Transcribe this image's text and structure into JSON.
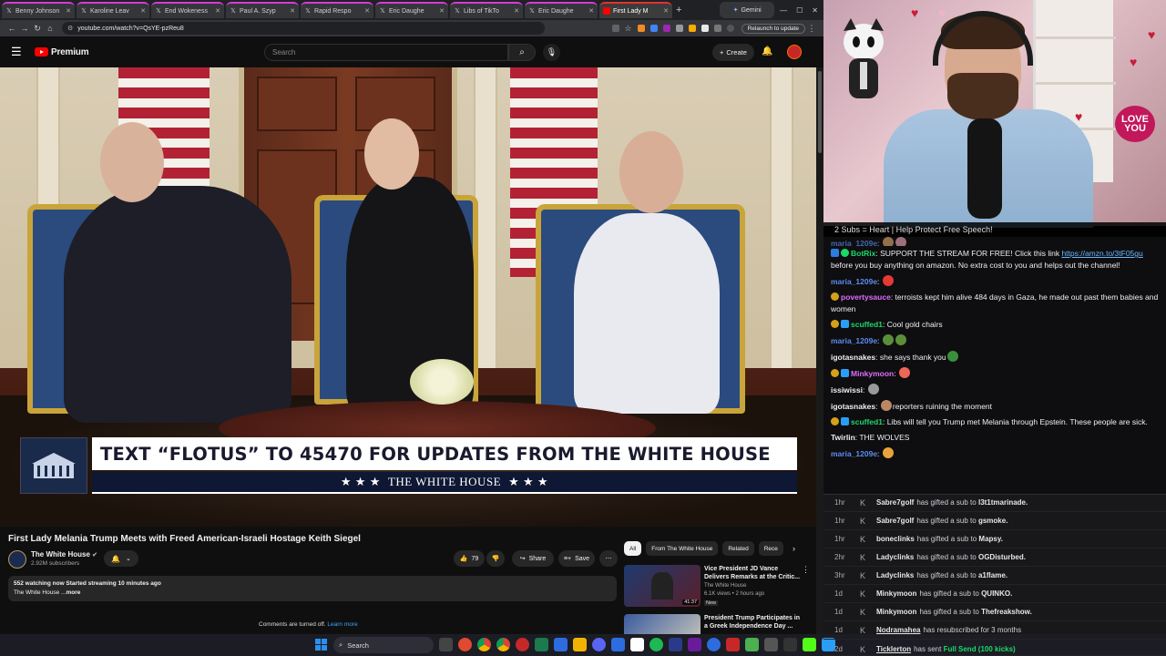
{
  "browser": {
    "tabs": [
      {
        "label": "Benny Johnson",
        "icon": "x-icon",
        "active": false
      },
      {
        "label": "Karoline Leav",
        "icon": "x-icon",
        "active": false
      },
      {
        "label": "End Wokeness",
        "icon": "x-icon",
        "active": false
      },
      {
        "label": "Paul A. Szyp",
        "icon": "x-icon",
        "active": false
      },
      {
        "label": "Rapid Respo",
        "icon": "x-icon",
        "active": false
      },
      {
        "label": "Eric Daughe",
        "icon": "x-icon",
        "active": false
      },
      {
        "label": "Libs of TikTo",
        "icon": "x-icon",
        "active": false
      },
      {
        "label": "Eric Daughe",
        "icon": "x-icon",
        "active": false
      },
      {
        "label": "First Lady M",
        "icon": "youtube-icon",
        "active": true
      }
    ],
    "gemini_tab": "Gemini",
    "url": "youtube.com/watch?v=QsYE-pzReu8",
    "relaunch": "Relaunch to update"
  },
  "youtube": {
    "logo_text": "Premium",
    "search_placeholder": "Search",
    "create_label": "Create",
    "video": {
      "lower_third_main": "TEXT “FLOTUS” TO 45470 FOR UPDATES FROM THE WHITE HOUSE",
      "lower_third_sub": "THE WHITE HOUSE",
      "stars": "★ ★ ★"
    },
    "title": "First Lady Melania Trump Meets with Freed American-Israeli Hostage Keith Siegel",
    "channel": {
      "name": "The White House",
      "subs": "2.92M subscribers"
    },
    "likes": "79",
    "share_label": "Share",
    "save_label": "Save",
    "description": {
      "stats": "552 watching now  Started streaming 10 minutes ago",
      "text": "The White House ...",
      "more": "more"
    },
    "comments_off": "Comments are turned off.",
    "learn_more": "Learn more",
    "chips": [
      "All",
      "From The White House",
      "Related",
      "Rece"
    ],
    "recommendations": [
      {
        "title": "Vice President JD Vance Delivers Remarks at the Critic...",
        "channel": "The White House",
        "views": "6.1K views • 2 hours ago",
        "badge": "New",
        "duration": "41:37"
      },
      {
        "title": "President Trump Participates in a Greek Independence Day ...",
        "channel": "",
        "views": "",
        "badge": "",
        "duration": ""
      }
    ]
  },
  "stream": {
    "sub_banner": "2 Subs = Heart | Help Protect Free Speech!",
    "love_sign": "LOVE YOU",
    "chat": [
      {
        "user": "maria_1209e",
        "color": "#5b8def",
        "text": ""
      },
      {
        "user": "BotRix",
        "color": "#1bd96a",
        "text": "SUPPORT THE STREAM FOR FREE! Click this link ",
        "link": "https://amzn.to/3tF05gu",
        "after": " before you buy anything on amazon. No extra cost to you and helps out the channel!"
      },
      {
        "user": "maria_1209e",
        "color": "#5b8def",
        "text": ""
      },
      {
        "user": "povertysauce",
        "color": "#e06cff",
        "text": "terroists kept him alive 484 days in Gaza, he made out past them babies and women"
      },
      {
        "user": "scuffed1",
        "color": "#1bd96a",
        "text": "Cool gold chairs"
      },
      {
        "user": "maria_1209e",
        "color": "#5b8def",
        "text": ""
      },
      {
        "user": "igotasnakes",
        "color": "#efeff1",
        "text": "she says thank you"
      },
      {
        "user": "Minkymoon",
        "color": "#e06cff",
        "text": ""
      },
      {
        "user": "issiwissi",
        "color": "#efeff1",
        "text": ""
      },
      {
        "user": "igotasnakes",
        "color": "#efeff1",
        "text": "reporters ruining the moment"
      },
      {
        "user": "scuffed1",
        "color": "#1bd96a",
        "text": "Libs will tell you Trump met Melania through Epstein. These people are sick."
      },
      {
        "user": "Twirlin",
        "color": "#efeff1",
        "text": "THE WOLVES"
      },
      {
        "user": "maria_1209e",
        "color": "#5b8def",
        "text": ""
      }
    ],
    "events": [
      {
        "time": "1hr",
        "user": "Sabre7golf",
        "text": "has gifted a sub to",
        "target": "l3t1tmarinade."
      },
      {
        "time": "1hr",
        "user": "Sabre7golf",
        "text": "has gifted a sub to",
        "target": "gsmoke."
      },
      {
        "time": "1hr",
        "user": "boneclinks",
        "text": "has gifted a sub to",
        "target": "Mapsy."
      },
      {
        "time": "2hr",
        "user": "Ladyclinks",
        "text": "has gifted a sub to",
        "target": "OGDisturbed."
      },
      {
        "time": "3hr",
        "user": "Ladyclinks",
        "text": "has gifted a sub to",
        "target": "a1flame."
      },
      {
        "time": "1d",
        "user": "Minkymoon",
        "text": "has gifted a sub to",
        "target": "QUINKO."
      },
      {
        "time": "1d",
        "user": "Minkymoon",
        "text": "has gifted a sub to",
        "target": "Thefreakshow."
      },
      {
        "time": "1d",
        "user": "Nodramahea",
        "text": "has resubscribed for 3 months",
        "target": ""
      },
      {
        "time": "2d",
        "user": "Ticklerton",
        "text": "has sent",
        "target": "Full Send (100 kicks)"
      }
    ]
  },
  "taskbar": {
    "search_placeholder": "Search"
  }
}
